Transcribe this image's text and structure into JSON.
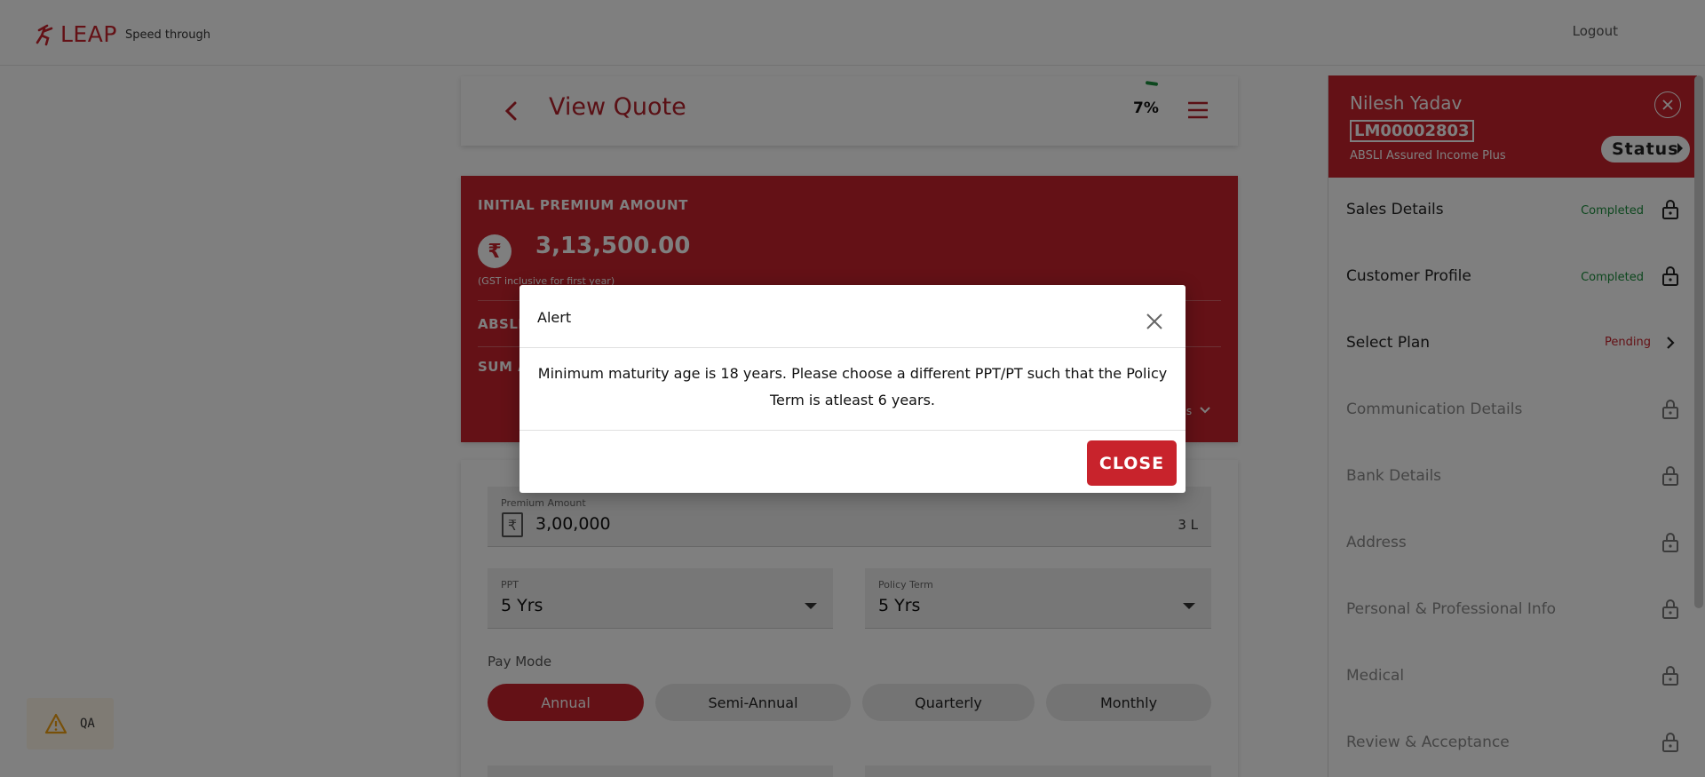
{
  "header": {
    "logo_text": "LEAP",
    "tagline": "Speed through",
    "logout_label": "Logout"
  },
  "quote": {
    "title": "View Quote",
    "progress": "7%"
  },
  "premium_card": {
    "label": "INITIAL PREMIUM AMOUNT",
    "currency_symbol": "₹",
    "amount": "3,13,500.00",
    "note": "(GST inclusive for first year)",
    "row1_label": "ABSLI",
    "row2_label": "SUM A",
    "more_label": "s"
  },
  "form": {
    "premium_amount": {
      "label": "Premium Amount",
      "value": "3,00,000",
      "suffix": "3 L",
      "symbol": "₹"
    },
    "ppt": {
      "label": "PPT",
      "value": "5 Yrs"
    },
    "policy_term": {
      "label": "Policy Term",
      "value": "5 Yrs"
    },
    "pay_mode_label": "Pay Mode",
    "pay_modes": [
      "Annual",
      "Semi-Annual",
      "Quarterly",
      "Monthly"
    ],
    "selected_pay_mode": "Annual"
  },
  "sidebar": {
    "customer_name": "Nilesh Yadav",
    "lead_id": "LM00002803",
    "plan_name": "ABSLI Assured Income Plus",
    "status_button": "Status",
    "items": [
      {
        "label": "Sales Details",
        "status": "Completed",
        "icon": "lock-icon"
      },
      {
        "label": "Customer Profile",
        "status": "Completed",
        "icon": "lock-icon"
      },
      {
        "label": "Select Plan",
        "status": "Pending",
        "icon": "chevron-right-icon"
      },
      {
        "label": "Communication Details",
        "status": "",
        "icon": "lock-icon"
      },
      {
        "label": "Bank Details",
        "status": "",
        "icon": "lock-icon"
      },
      {
        "label": "Address",
        "status": "",
        "icon": "lock-icon"
      },
      {
        "label": "Personal & Professional Info",
        "status": "",
        "icon": "lock-icon"
      },
      {
        "label": "Medical",
        "status": "",
        "icon": "lock-icon"
      },
      {
        "label": "Review & Acceptance",
        "status": "",
        "icon": "lock-icon"
      }
    ]
  },
  "qa_badge": {
    "label": "QA"
  },
  "dialog": {
    "title": "Alert",
    "message": "Minimum maturity age is 18 years. Please choose a different PPT/PT such that the Policy Term is atleast 6 years.",
    "close_button": "CLOSE"
  },
  "colors": {
    "brand_red": "#c8232c",
    "completed_green": "#1b8e3d",
    "overlay": "rgba(0,0,0,0.5)"
  }
}
